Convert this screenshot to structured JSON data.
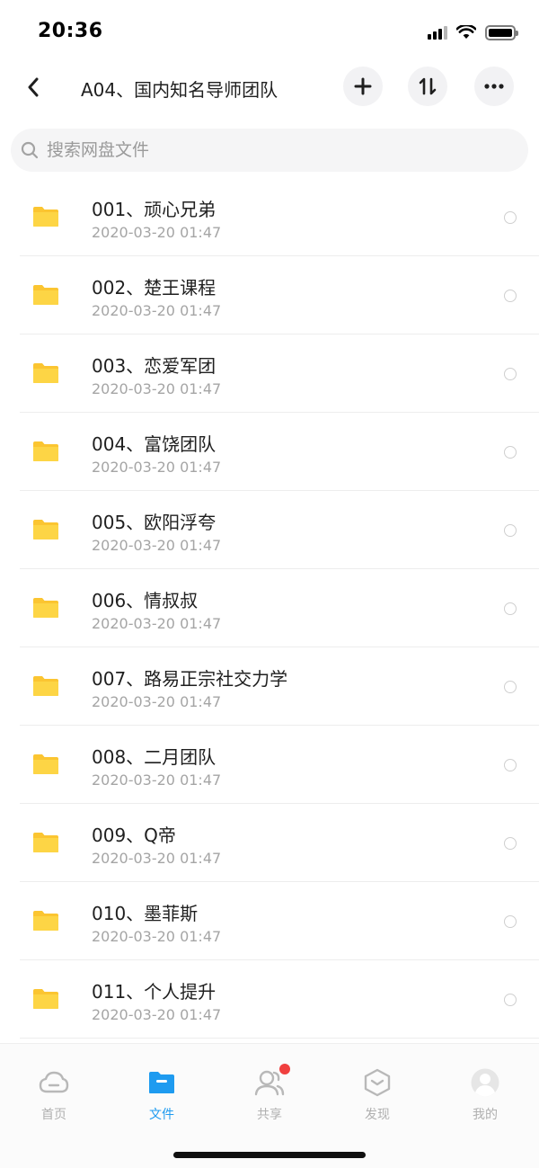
{
  "status_bar": {
    "time": "20:36",
    "icons": [
      "cellular-signal-icon",
      "wifi-icon",
      "battery-icon"
    ]
  },
  "header": {
    "title": "A04、国内知名导师团队",
    "back_icon": "chevron-left-icon",
    "actions": [
      "add-icon",
      "sort-icon",
      "more-icon"
    ]
  },
  "search": {
    "placeholder": "搜索网盘文件"
  },
  "files": [
    {
      "name": "001、顽心兄弟",
      "date": "2020-03-20 01:47"
    },
    {
      "name": "002、楚王课程",
      "date": "2020-03-20 01:47"
    },
    {
      "name": "003、恋爱军团",
      "date": "2020-03-20 01:47"
    },
    {
      "name": "004、富饶团队",
      "date": "2020-03-20 01:47"
    },
    {
      "name": "005、欧阳浮夸",
      "date": "2020-03-20 01:47"
    },
    {
      "name": "006、情叔叔",
      "date": "2020-03-20 01:47"
    },
    {
      "name": "007、路易正宗社交力学",
      "date": "2020-03-20 01:47"
    },
    {
      "name": "008、二月团队",
      "date": "2020-03-20 01:47"
    },
    {
      "name": "009、Q帝",
      "date": "2020-03-20 01:47"
    },
    {
      "name": "010、墨菲斯",
      "date": "2020-03-20 01:47"
    },
    {
      "name": "011、个人提升",
      "date": "2020-03-20 01:47"
    }
  ],
  "tabs": [
    {
      "label": "首页",
      "icon": "cloud-icon",
      "active": false
    },
    {
      "label": "文件",
      "icon": "folder-icon",
      "active": true
    },
    {
      "label": "共享",
      "icon": "people-icon",
      "active": false,
      "badge": true
    },
    {
      "label": "发现",
      "icon": "discover-icon",
      "active": false
    },
    {
      "label": "我的",
      "icon": "avatar-icon",
      "active": false
    }
  ],
  "colors": {
    "accent": "#1e9bf0",
    "folder": "#fbc531",
    "badge": "#f0403f",
    "inactive_tab": "#b0b0b0"
  }
}
